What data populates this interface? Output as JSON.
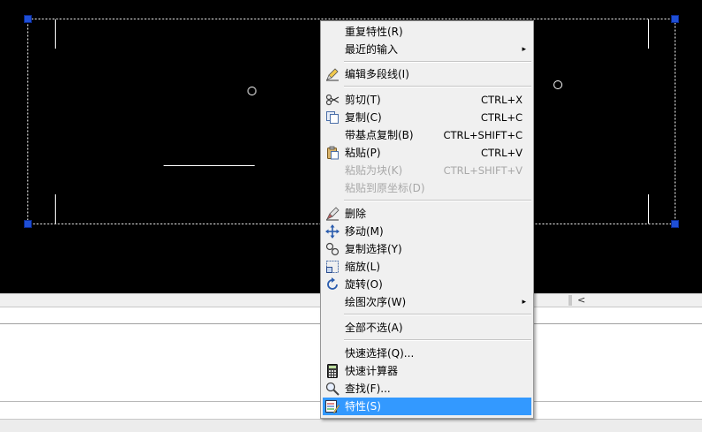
{
  "context_menu": {
    "items": [
      {
        "label": "重复特性(R)"
      },
      {
        "label": "最近的输入"
      },
      {
        "label": "编辑多段线(I)"
      },
      {
        "label": "剪切(T)",
        "shortcut": "CTRL+X"
      },
      {
        "label": "复制(C)",
        "shortcut": "CTRL+C"
      },
      {
        "label": "带基点复制(B)",
        "shortcut": "CTRL+SHIFT+C"
      },
      {
        "label": "粘贴(P)",
        "shortcut": "CTRL+V"
      },
      {
        "label": "粘贴为块(K)",
        "shortcut": "CTRL+SHIFT+V"
      },
      {
        "label": "粘贴到原坐标(D)"
      },
      {
        "label": "删除"
      },
      {
        "label": "移动(M)"
      },
      {
        "label": "复制选择(Y)"
      },
      {
        "label": "缩放(L)"
      },
      {
        "label": "旋转(O)"
      },
      {
        "label": "绘图次序(W)"
      },
      {
        "label": "全部不选(A)"
      },
      {
        "label": "快速选择(Q)..."
      },
      {
        "label": "快速计算器"
      },
      {
        "label": "查找(F)..."
      },
      {
        "label": "特性(S)"
      }
    ]
  },
  "scrollbar": {
    "arrow": "<"
  },
  "icons": {
    "submenu_arrow": "▸",
    "names": [
      "pencil-icon",
      "scissors-icon",
      "copy-icon",
      "paste-icon",
      "erase-icon",
      "move-icon",
      "copy-selection-icon",
      "scale-icon",
      "rotate-icon",
      "calculator-icon",
      "find-icon",
      "properties-icon"
    ]
  },
  "colors": {
    "canvas": "#000000",
    "grip": "#1f4fd6",
    "menu_bg": "#f0f0f0",
    "highlight": "#3399ff",
    "disabled": "#a8a8a8"
  }
}
